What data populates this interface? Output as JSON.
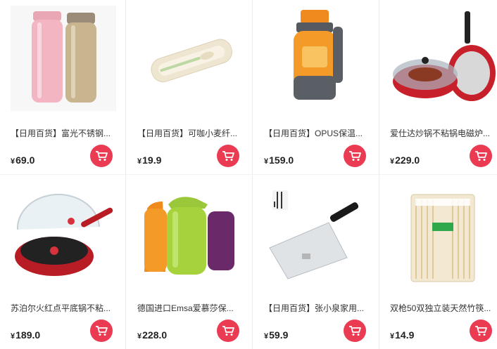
{
  "currency_symbol": "¥",
  "accent_color": "#ea3b53",
  "products": [
    {
      "title": "【日用百货】富光不锈钢...",
      "price": "69.0",
      "image": "thermos-bottles-pink-gold"
    },
    {
      "title": "【日用百货】可咖小麦纤...",
      "price": "19.9",
      "image": "wheat-fiber-cutlery-box"
    },
    {
      "title": "【日用百货】OPUS保温...",
      "price": "159.0",
      "image": "orange-gray-vacuum-flask"
    },
    {
      "title": "爱仕达炒锅不粘锅电磁炉...",
      "price": "229.0",
      "image": "red-wok-with-lid"
    },
    {
      "title": "苏泊尔火红点平底锅不粘...",
      "price": "189.0",
      "image": "red-frying-pan-with-lid"
    },
    {
      "title": "德国进口Emsa爱慕莎保...",
      "price": "228.0",
      "image": "three-colored-thermos-jugs"
    },
    {
      "title": "【日用百货】张小泉家用...",
      "price": "59.9",
      "image": "kitchen-cleaver-knife"
    },
    {
      "title": "双枪50双独立装天然竹筷...",
      "price": "14.9",
      "image": "bamboo-chopsticks-pack"
    }
  ]
}
